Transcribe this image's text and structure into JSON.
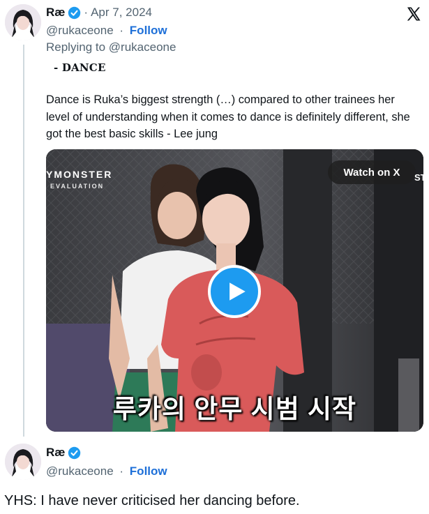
{
  "tweet1": {
    "name": "Ræ",
    "verified_icon": "verified-badge-icon",
    "separator": "·",
    "date": "Apr 7, 2024",
    "handle": "@rukaceone",
    "follow_sep": "·",
    "follow_label": "Follow",
    "reply_prefix": "Replying to ",
    "reply_handle": "@rukaceone",
    "heading": "- DANCE",
    "body": "Dance is Ruka’s biggest strength (…) compared to other trainees her level of understanding when it comes to dance is definitely different, she got the best basic skills - Lee jung",
    "video": {
      "watch_label": "Watch on X",
      "watch_extra": "ST",
      "brand": "YMONSTER",
      "brand_sub": "EVALUATION",
      "caption": "루카의 안무 시범 시작",
      "play_icon": "play-icon"
    }
  },
  "tweet2": {
    "name": "Ræ",
    "verified_icon": "verified-badge-icon",
    "handle": "@rukaceone",
    "follow_sep": "·",
    "follow_label": "Follow"
  },
  "platform_logo": "x-logo-icon",
  "footer_text": "YHS: I have never criticised her dancing before.",
  "colors": {
    "link": "#1d6fd8",
    "verified": "#1d9bf0",
    "muted": "#536471",
    "play_button": "#1d9bf0"
  }
}
